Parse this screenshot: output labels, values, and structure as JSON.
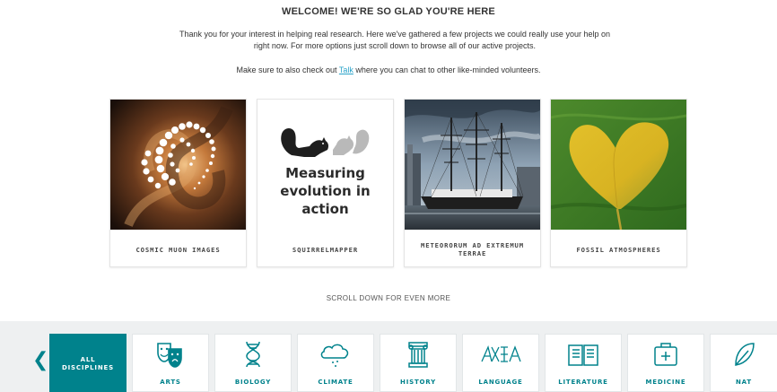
{
  "header": {
    "title": "WELCOME! WE'RE SO GLAD YOU'RE HERE",
    "intro": "Thank you for your interest in helping real research. Here we've gathered a few projects we could really use your help on right now. For more options just scroll down to browse all of our active projects.",
    "talk_before": "Make sure to also check out ",
    "talk_link": "Talk",
    "talk_after": " where you can chat to other like-minded volunteers."
  },
  "projects": [
    {
      "name": "COSMIC MUON IMAGES"
    },
    {
      "name": "SQUIRRELMAPPER",
      "image_text_1": "Measuring",
      "image_text_2": "evolution in",
      "image_text_3": "action"
    },
    {
      "name": "METEORORUM AD EXTREMUM TERRAE"
    },
    {
      "name": "FOSSIL ATMOSPHERES"
    }
  ],
  "scroll_more": "SCROLL DOWN FOR EVEN MORE",
  "disciplines": [
    {
      "label": "ALL DISCIPLINES",
      "label_1": "ALL",
      "label_2": "DISCIPLINES",
      "icon": "all",
      "active": true
    },
    {
      "label": "ARTS",
      "icon": "theater-masks-icon"
    },
    {
      "label": "BIOLOGY",
      "icon": "dna-icon"
    },
    {
      "label": "CLIMATE",
      "icon": "rain-cloud-icon"
    },
    {
      "label": "HISTORY",
      "icon": "column-icon"
    },
    {
      "label": "LANGUAGE",
      "icon": "script-icon"
    },
    {
      "label": "LITERATURE",
      "icon": "open-book-icon"
    },
    {
      "label": "MEDICINE",
      "icon": "medical-kit-icon"
    },
    {
      "label": "NAT",
      "icon": "leaf-icon"
    }
  ],
  "colors": {
    "accent": "#00828c",
    "link": "#2aa3c9",
    "strip_bg": "#eef0f1"
  }
}
